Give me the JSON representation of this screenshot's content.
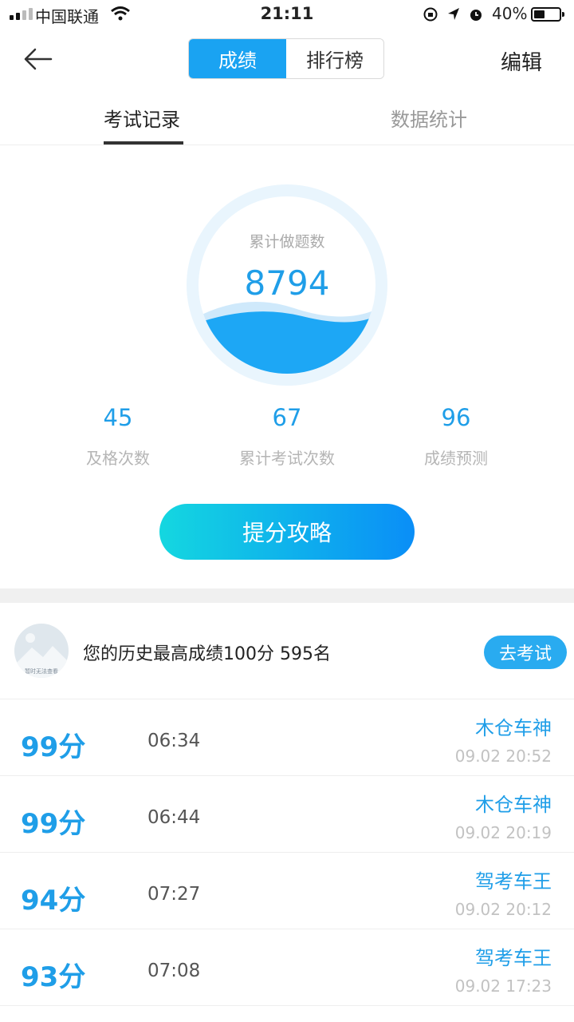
{
  "status_bar": {
    "carrier": "中国联通",
    "time": "21:11",
    "battery": "40%"
  },
  "nav": {
    "tabs": [
      "成绩",
      "排行榜"
    ],
    "edit": "编辑"
  },
  "subtabs": [
    "考试记录",
    "数据统计"
  ],
  "summary": {
    "label": "累计做题数",
    "value": "8794"
  },
  "stats": [
    {
      "value": "45",
      "label": "及格次数"
    },
    {
      "value": "67",
      "label": "累计考试次数"
    },
    {
      "value": "96",
      "label": "成绩预测"
    }
  ],
  "boost_button": "提分攻略",
  "best": {
    "text": "您的历史最高成绩100分  595名",
    "avatar_caption": "暂时无法查看",
    "go_button": "去考试"
  },
  "records": [
    {
      "score": "99分",
      "duration": "06:34",
      "name": "木仓车神",
      "date": "09.02 20:52"
    },
    {
      "score": "99分",
      "duration": "06:44",
      "name": "木仓车神",
      "date": "09.02 20:19"
    },
    {
      "score": "94分",
      "duration": "07:27",
      "name": "驾考车王",
      "date": "09.02 20:12"
    },
    {
      "score": "93分",
      "duration": "07:08",
      "name": "驾考车王",
      "date": "09.02 17:23"
    }
  ],
  "colors": {
    "accent": "#1f9ee8",
    "tab_active": "#1aa3f2",
    "button_start": "#14d7e0",
    "button_end": "#0a8ef7"
  }
}
